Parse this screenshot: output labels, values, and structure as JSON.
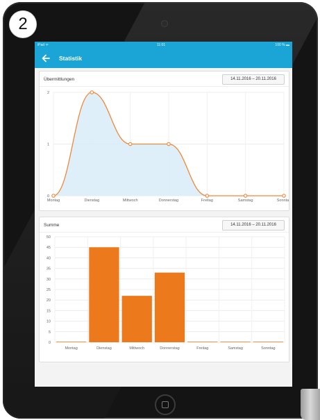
{
  "step_badge": "2",
  "status_bar": {
    "carrier": "iPad ᯤ",
    "time": "11:01",
    "battery": "100 % ▬"
  },
  "nav": {
    "title": "Statistik",
    "back_icon": "back-arrow-icon"
  },
  "colors": {
    "accent": "#1aa5d6",
    "line": "#f0873a",
    "area_fill": "#d9ecf8",
    "bar": "#ec7a1c"
  },
  "chart_data": [
    {
      "type": "area",
      "title": "Übermittlungen",
      "date_range": "14.11.2016 – 20.11.2016",
      "categories": [
        "Montag",
        "Dienstag",
        "Mittwoch",
        "Donnerstag",
        "Freitag",
        "Samstag",
        "Sonntag"
      ],
      "values": [
        0,
        2,
        1,
        1,
        0,
        0,
        0
      ],
      "ylim": [
        0,
        2
      ],
      "yticks": [
        "0",
        "1",
        "2"
      ],
      "grid": true,
      "smooth": true
    },
    {
      "type": "bar",
      "title": "Summe",
      "date_range": "14.11.2016 – 20.11.2016",
      "categories": [
        "Montag",
        "Dienstag",
        "Mittwoch",
        "Donnerstag",
        "Freitag",
        "Samstag",
        "Sonntag"
      ],
      "values": [
        0,
        45,
        22,
        33,
        0,
        0,
        0
      ],
      "ylim": [
        0,
        50
      ],
      "yticks": [
        "0",
        "5",
        "10",
        "15",
        "20",
        "25",
        "30",
        "35",
        "40",
        "45",
        "50"
      ],
      "grid": true
    }
  ]
}
